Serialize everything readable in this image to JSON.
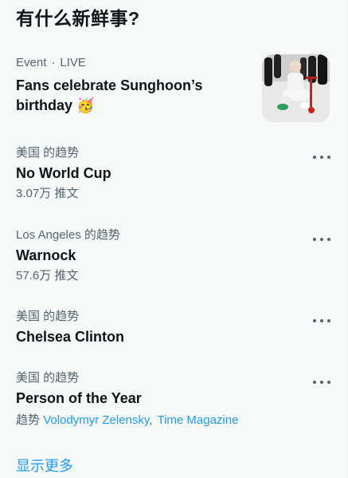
{
  "panel": {
    "title": "有什么新鲜事?"
  },
  "event": {
    "category": "Event",
    "separator": "·",
    "status": "LIVE",
    "headline": "Fans celebrate Sunghoon’s birthday",
    "emoji": "🥳"
  },
  "trends": [
    {
      "context": "美国 的趋势",
      "name": "No World Cup",
      "tweets": "3.07万 推文"
    },
    {
      "context": "Los Angeles 的趋势",
      "name": "Warnock",
      "tweets": "57.6万 推文"
    },
    {
      "context": "美国 的趋势",
      "name": "Chelsea Clinton"
    },
    {
      "context": "美国 的趋势",
      "name": "Person of the Year",
      "related_prefix": "趋势",
      "related_1": "Volodymyr Zelensky",
      "related_sep": ",",
      "related_2": "Time Magazine"
    }
  ],
  "show_more": "显示更多",
  "colors": {
    "background": "#f7f9f9",
    "primary_text": "#0f1419",
    "secondary_text": "#536471",
    "accent": "#1d9bf0"
  },
  "icons": {
    "more": "more-horizontal-icon"
  }
}
